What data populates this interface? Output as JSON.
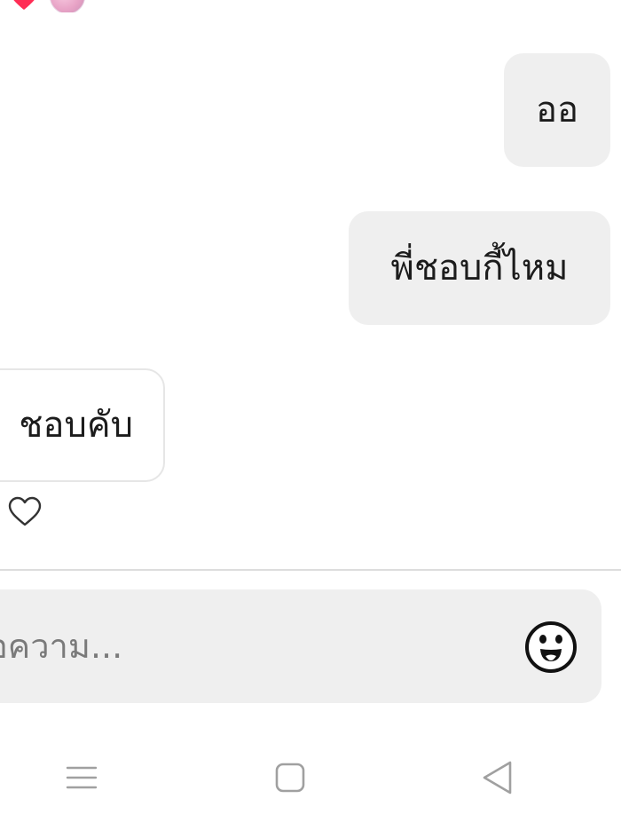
{
  "messages": [
    {
      "direction": "outgoing",
      "text": "ออ"
    },
    {
      "direction": "outgoing",
      "text": "พี่ชอบกี้ไหม"
    },
    {
      "direction": "incoming",
      "text": "ชอบคับ"
    }
  ],
  "composer": {
    "placeholder": "ข้อความ..."
  },
  "icons": {
    "top_reaction": "heart-icon",
    "top_avatar": "avatar",
    "like": "heart-outline-icon",
    "emoji": "emoji-icon",
    "nav_menu": "menu-icon",
    "nav_home": "home-icon",
    "nav_back": "back-icon"
  },
  "colors": {
    "bubble_outgoing": "#efefef",
    "bubble_incoming_border": "#e6e6e6",
    "reaction_heart": "#ff2d55",
    "text": "#1c1c1c",
    "placeholder": "#7a7a7a",
    "nav_icon": "#a0a0a0"
  }
}
